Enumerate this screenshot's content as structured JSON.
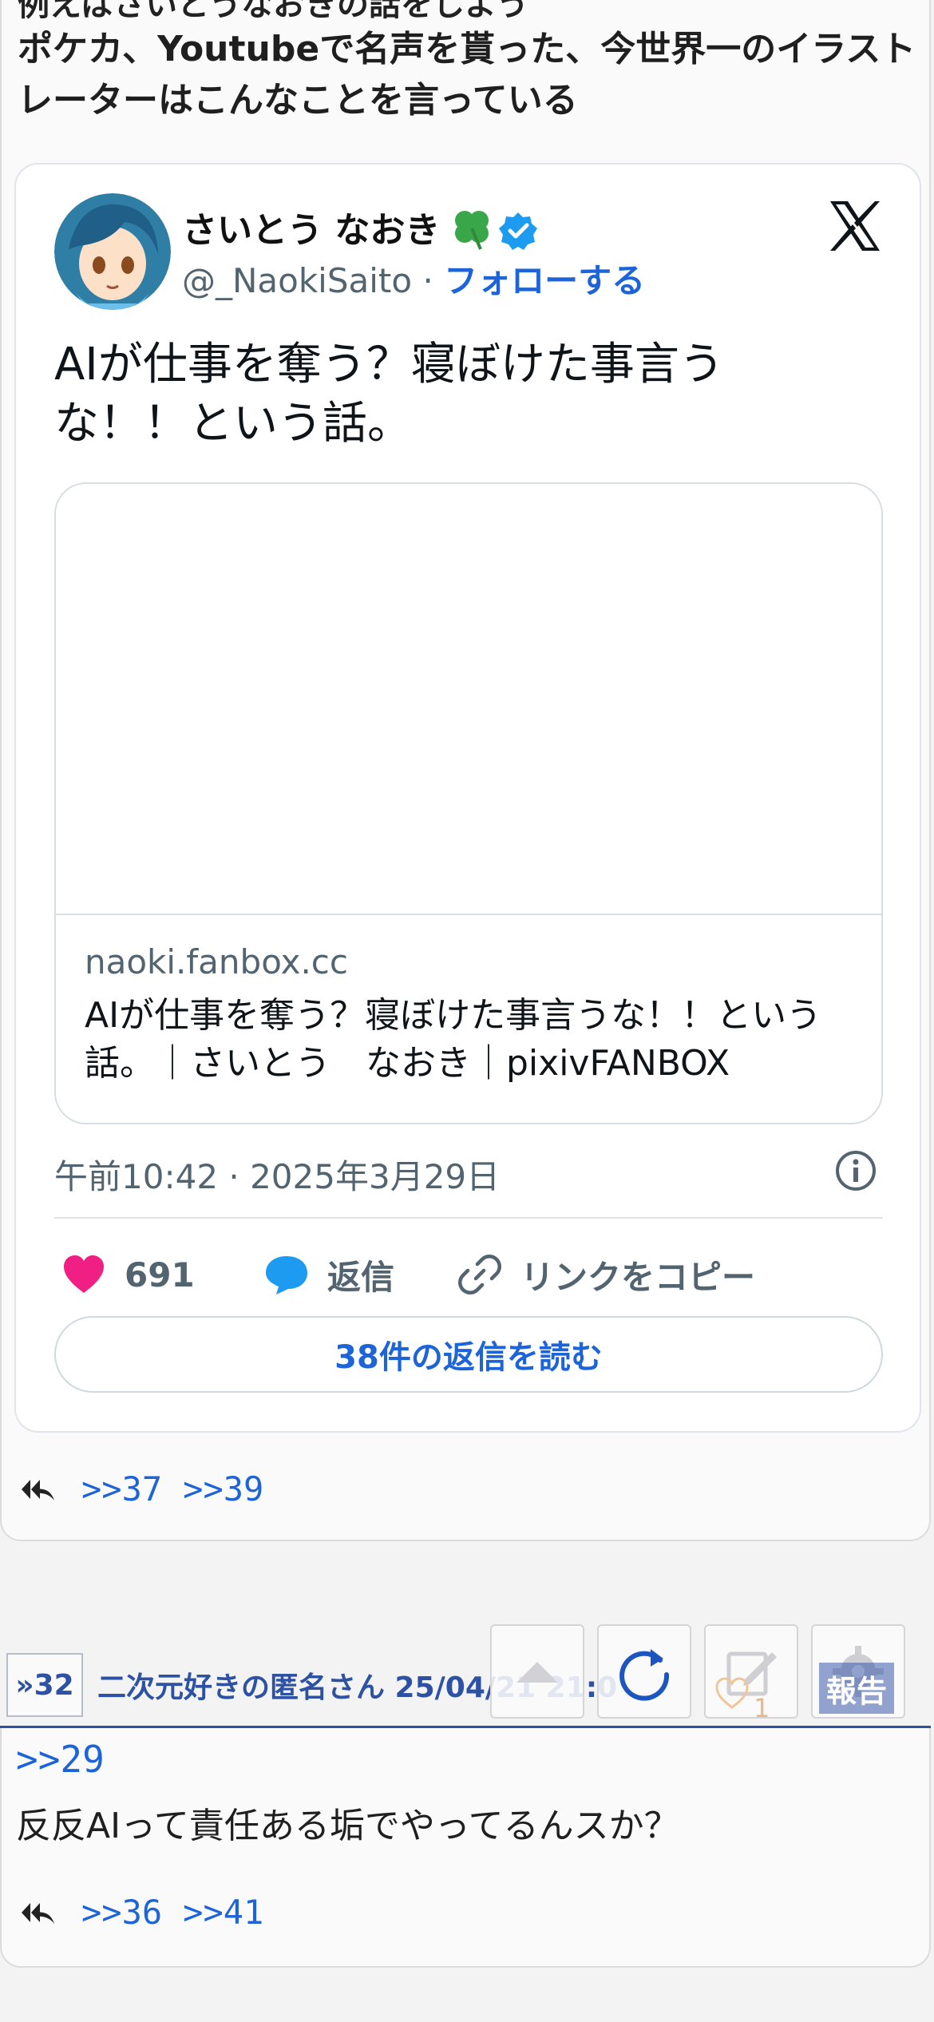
{
  "post_top": {
    "cut_line": "例えばさいとうなおきの話をしよう",
    "body": "ポケカ、Youtubeで名声を貰った、今世界一のイラストレーターはこんなことを言っている",
    "tweet": {
      "author_name": "さいとう なおき",
      "handle": "@_NaokiSaito",
      "separator": "·",
      "follow_label": "フォローする",
      "text": "AIが仕事を奪う？寝ぼけた事言うな！！という話。",
      "link_domain": "naoki.fanbox.cc",
      "link_title": "AIが仕事を奪う？寝ぼけた事言うな！！という話。｜さいとう　なおき｜pixivFANBOX",
      "timestamp": "午前10:42 · 2025年3月29日",
      "like_count": "691",
      "reply_label": "返信",
      "copy_link_label": "リンクをコピー",
      "read_replies_label": "38件の返信を読む"
    },
    "reply_refs": [
      ">>37",
      ">>39"
    ]
  },
  "post_2": {
    "number": "»32",
    "meta": "二次元好きの匿名さん 25/04/21 21:0",
    "anchor": ">>29",
    "text": "反反AIって責任ある垢でやってるんスか？",
    "reply_refs": [
      ">>36",
      ">>41"
    ]
  },
  "toolbar": {
    "like_count": "1",
    "report_label": "報告"
  },
  "colors": {
    "link_blue": "#1d64d8",
    "like_pink": "#f01f83",
    "verified_blue": "#1d9bf0",
    "post_header_blue": "#2d52a3"
  },
  "icons": [
    "clover-icon",
    "verified-icon",
    "x-logo-icon",
    "info-icon",
    "heart-icon",
    "reply-bubble-icon",
    "link-icon",
    "reply-arrow-icon",
    "scroll-up-icon",
    "reload-icon",
    "edit-icon",
    "heart-outline-icon",
    "gear-icon"
  ]
}
